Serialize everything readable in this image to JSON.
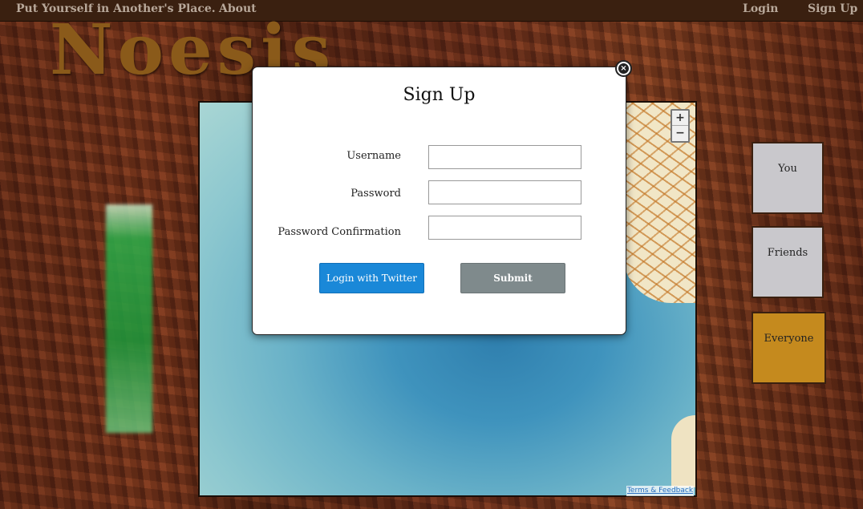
{
  "nav": {
    "home": "Put Yourself in Another's Place.",
    "about": "About",
    "login": "Login",
    "signup": "Sign Up"
  },
  "logo": "Noesis",
  "map": {
    "zoom_in": "+",
    "zoom_out": "−",
    "terms": "Terms & Feedback"
  },
  "filters": {
    "you": "You",
    "friends": "Friends",
    "everyone": "Everyone",
    "active": "Everyone"
  },
  "modal": {
    "title": "Sign Up",
    "close": "×",
    "username_label": "Username",
    "password_label": "Password",
    "confirm_label": "Password Confirmation",
    "username_value": "",
    "password_value": "",
    "confirm_value": "",
    "twitter_button": "Login with Twitter",
    "submit_button": "Submit"
  },
  "colors": {
    "topbar": "#3a2010",
    "logo": "#8a5a1a",
    "twitter": "#1a88d8",
    "submit": "#7f8a8c",
    "active_filter": "#c58a1e"
  }
}
